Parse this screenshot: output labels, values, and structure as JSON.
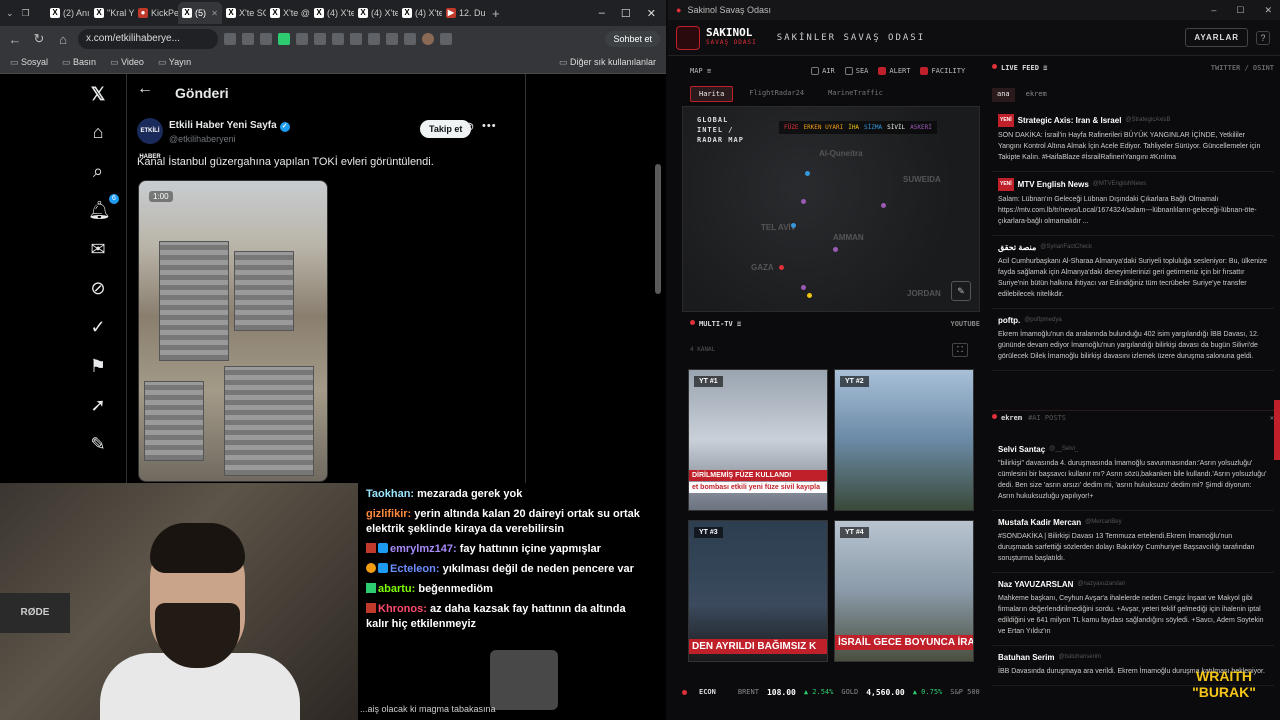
{
  "browser": {
    "tabs": [
      "(2) Anı",
      "\"Kral Y",
      "KickPe",
      "(5)",
      "X'te SC",
      "X'te @",
      "(4) X'te",
      "(4) X'te",
      "(4) X'te",
      "12. Du"
    ],
    "url": "x.com/etkilihaberye...",
    "sohbet": "Sohbet et",
    "bookmarks": [
      "Sosyal",
      "Basın",
      "Video",
      "Yayın"
    ],
    "bookmarks_right": "Diğer sık kullanılanlar"
  },
  "x": {
    "header": "Gönderi",
    "display_name": "Etkili Haber Yeni Sayfa",
    "handle": "@etkilihaberyeni",
    "follow": "Takip et",
    "tweet": "Kanal İstanbul güzergahına yapılan TOKİ evleri görüntülendi.",
    "media_time": "1:00",
    "notif": "6",
    "avatar_text": "ETKİLİ HABER"
  },
  "stream": {
    "mic_label": "RØDE",
    "chat": [
      {
        "user": "Taokhan:",
        "user_color": "#9ae6ff",
        "text": "mezarada gerek yok"
      },
      {
        "user": "gizlifikir:",
        "user_color": "#ff8a3d",
        "text": "yerin altında kalan 20 daireyi ortak su ortak elektrik şeklinde kiraya da verebilirsin"
      },
      {
        "user": "emrylmz147:",
        "user_color": "#a78bfa",
        "text": "fay hattının içine yapmışlar",
        "badges": true
      },
      {
        "user": "Ecteleon:",
        "user_color": "#6b8cff",
        "text": "yıkılması değil de neden pencere var",
        "badges": true
      },
      {
        "user": "abartu:",
        "user_color": "#7CFC00",
        "text": "beğenmediöm"
      },
      {
        "user": "Khronos:",
        "user_color": "#ff4d6d",
        "text": "az daha kazsak fay hattının da altında kalır hiç etkilenmeyiz"
      }
    ],
    "footer": "...aiş olacak ki magma tabakasına"
  },
  "app": {
    "window_title": "Sakinol Savaş Odası",
    "logo": "SAKINOL",
    "logo_sub": "SAVAŞ ODASI",
    "title": "SAKİNLER SAVAŞ ODASI",
    "settings": "AYARLAR",
    "help": "?",
    "map_label": "MAP ≡",
    "filters": [
      {
        "label": "AIR",
        "on": false
      },
      {
        "label": "SEA",
        "on": false
      },
      {
        "label": "ALERT",
        "on": true
      },
      {
        "label": "FACILITY",
        "on": true
      }
    ],
    "map_tabs": [
      "Harita",
      "FlightRadar24",
      "MarineTraffic"
    ],
    "radar_title": [
      "GLOBAL",
      "INTEL /",
      "RADAR MAP"
    ],
    "legend": [
      "FÜZE",
      "ERKEN UYARI",
      "İHA",
      "SİZMA",
      "SİVİL",
      "ASKERİ"
    ],
    "map_labels": [
      "Al-Quneitra",
      "SUWEIDA",
      "TEL AVİV",
      "AMMAN",
      "GAZA",
      "JORDAN"
    ],
    "mtv": "MULTI-TV ≡",
    "youtube": "YOUTUBE",
    "mtv_sub": "4 KANAL",
    "videos": [
      {
        "tag": "YT #1",
        "caption": "DİRİLMEMİŞ FÜZE KULLANDI",
        "caption2": "et bombası etkili yeni füze sivil kayıpla"
      },
      {
        "tag": "YT #2",
        "caption": "",
        "caption2": ""
      },
      {
        "tag": "YT #3",
        "caption": "DEN AYRILDI BAĞIMSIZ K",
        "caption2": ""
      },
      {
        "tag": "YT #4",
        "caption": "İSRAİL GECE BOYUNCA İRAN",
        "caption2": ""
      }
    ],
    "econ": {
      "label": "ECON",
      "brent_label": "BRENT",
      "brent": "108.00",
      "brent_chg": "▲ 2.54%",
      "gold_label": "GOLD",
      "gold": "4,560.00",
      "gold_chg": "▲ 0.75%",
      "sp": "S&P 500"
    },
    "livefeed": "LIVE FEED ≡",
    "livefeed_right": "TWITTER / OSINT",
    "feed_tabs": [
      "ana",
      "ekrem"
    ],
    "feed": [
      {
        "yeni": true,
        "source": "Strategic Axis: Iran & Israel",
        "handle": "@StrategicAxisB",
        "text": "SON DAKİKA: İsrail'in Hayfa Rafinerileri BÜYÜK YANGINLAR İÇİNDE, Yetkililer Yangını Kontrol Altına Almak İçin Acele Ediyor. Tahliyeler Sürüyor. Güncellemeler için Takipte Kalın. #HaifaBlaze #İsrailRafineriYangını #Kırılma"
      },
      {
        "yeni": true,
        "source": "MTV English News",
        "handle": "@MTVEnglishNews",
        "text": "Salam: Lübnan'ın Geleceği Lübnan Dışındaki Çıkarlara Bağlı Olmamalı https://mtv.com.lb/tr/news/Local/1674324/salam---lübnanlıların-geleceği-lübnan-öte-çıkarlara-bağlı olmamalıdır ..."
      },
      {
        "yeni": false,
        "source": "منصة تحقق",
        "handle": "@SyrianFactCheck",
        "text": "Acil Cumhurbaşkanı Al-Sharaa Almanya'daki Suriyeli topluluğa sesleniyor: Bu, ülkenize fayda sağlamak için Almanya'daki deneyimlerinizi geri getirmeniz için bir fırsattır Suriye'nin bütün halkına ihtiyacı var Edindiğiniz tüm tecrübeler Suriye'ye transfer edilebilecek nitelikdir."
      },
      {
        "yeni": false,
        "source": "poftp.",
        "handle": "@poftpmedya",
        "text": "Ekrem İmamoğlu'nun da aralarında bulunduğu 402 isim yargılandığı İBB Davası, 12. gününde devam ediyor İmamoğlu'nun yargılandığı bilirkişi davası da bugün Silivri'de görülecek Dilek İmamoğlu bilirkişi davasını izlemek üzere duruşma salonuna geldi."
      }
    ],
    "ekrem_head": "ekrem",
    "ekrem_sub": "#AI POSTS",
    "feed2": [
      {
        "source": "Selvi Santaç",
        "handle": "@__Selvi_",
        "text": "\"bilirkişi\" davasında 4. duruşmasında İmamoğlu savunmasından:'Asrın yolsuzluğu' cümlesini bir başsavcı kullanır mı? Asrın sözü,bakanken bile kullandı.'Asrın yolsuzluğu' dedi. Ben size 'asrın arsızı' dedim mi, 'asrın hukuksuzu' dedim mi? Şimdi diyorum: Asrın hukuksuzluğu yapılıyor!+"
      },
      {
        "source": "Mustafa Kadir Mercan",
        "handle": "@MercanBey",
        "text": "#SONDAKİKA | Bilirkişi Davası 13 Temmuza ertelendi.Ekrem İmamoğlu'nun duruşmada sarfettiği sözlerden dolayı Bakırköy Cumhuriyet Başsavcılığı tarafından soruşturma başlatıldı."
      },
      {
        "source": "Naz YAVUZARSLAN",
        "handle": "@nazyavuzarslan",
        "text": "Mahkeme başkanı, Ceyhun Avşar'a ihalelerde neden Cengiz İnşaat ve Makyol gibi firmaların değerlendirilmediğini sordu. +Avşar, yeteri teklif gelmediği için ihalenin iptal edildiğini ve 641 milyon TL kamu faydası sağlandığını söyledi. +Savcı, Adem Soytekin ve Ertan Yıldız'ın"
      },
      {
        "source": "Batuhan Serim",
        "handle": "@batuhanserim",
        "text": "İBB Davasında duruşmaya ara verildi. Ekrem İmamoğlu duruşma katılması bekleniyor."
      }
    ],
    "wraith": [
      "WRAITH",
      "\"BURAK\""
    ]
  }
}
